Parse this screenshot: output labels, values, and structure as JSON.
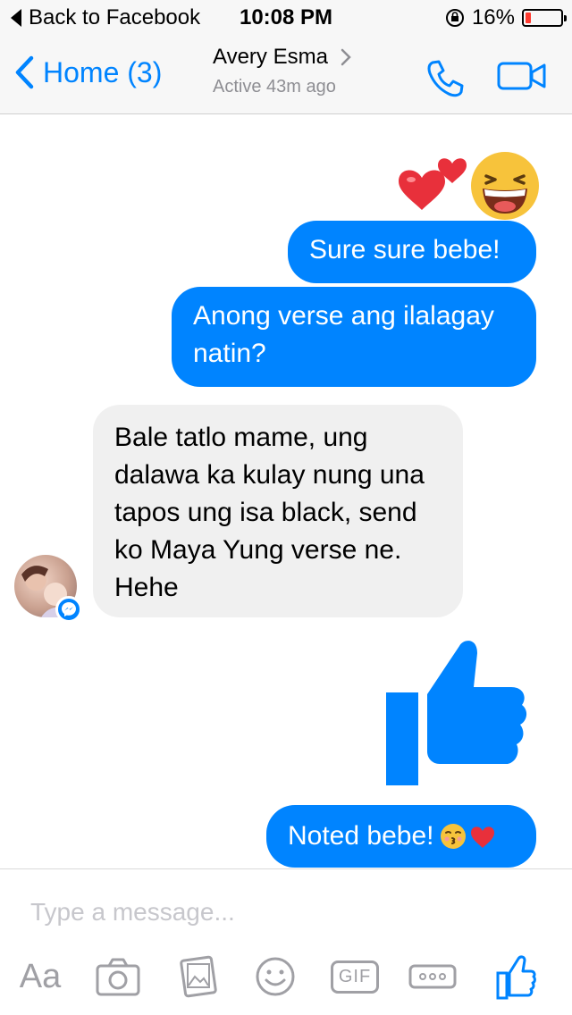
{
  "status_bar": {
    "back_label": "Back to Facebook",
    "time": "10:08 PM",
    "battery_text": "16%",
    "battery_level": 0.16,
    "battery_color": "#ff3b30"
  },
  "nav": {
    "back_label": "Home (3)",
    "contact_name": "Avery Esma",
    "contact_status": "Active 43m ago",
    "accent_color": "#0084ff"
  },
  "messages": [
    {
      "type": "emoji",
      "direction": "outgoing",
      "icons": [
        "hearts-icon",
        "laughing-face-icon"
      ]
    },
    {
      "type": "text",
      "direction": "outgoing",
      "lines": [
        "Sure sure bebe!"
      ]
    },
    {
      "type": "text",
      "direction": "outgoing",
      "lines": [
        "Anong verse ang ilalagay",
        "natin?"
      ]
    },
    {
      "type": "text",
      "direction": "incoming",
      "lines": [
        "Bale tatlo mame, ung",
        "dalawa ka kulay nung una",
        "tapos ung isa black, send",
        "ko Maya Yung verse ne.",
        "Hehe"
      ]
    },
    {
      "type": "like",
      "direction": "outgoing",
      "icon": "thumbs-up-icon"
    },
    {
      "type": "text",
      "direction": "outgoing",
      "lines": [
        "Noted bebe!"
      ],
      "trailing_icons": [
        "kissing-face-icon",
        "red-heart-icon"
      ]
    }
  ],
  "composer": {
    "placeholder": "Type a message...",
    "tools": [
      "text-style-icon",
      "camera-icon",
      "photo-gallery-icon",
      "emoji-icon",
      "gif-icon",
      "more-icon",
      "thumbs-up-icon"
    ],
    "text_tool_label": "Aa",
    "gif_label": "GIF"
  }
}
